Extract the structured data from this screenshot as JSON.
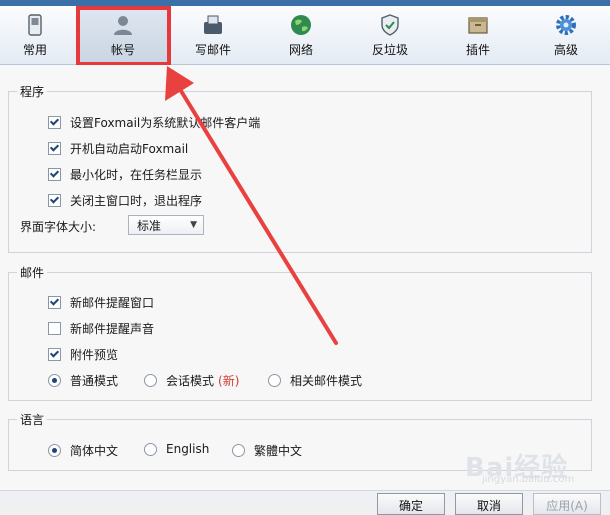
{
  "toolbar": {
    "tabs": [
      {
        "label": "常用",
        "icon": "phone-icon"
      },
      {
        "label": "帐号",
        "icon": "user-icon",
        "selected": true
      },
      {
        "label": "写邮件",
        "icon": "compose-icon"
      },
      {
        "label": "网络",
        "icon": "globe-icon"
      },
      {
        "label": "反垃圾",
        "icon": "shield-icon"
      },
      {
        "label": "插件",
        "icon": "box-icon"
      },
      {
        "label": "高级",
        "icon": "gear-icon"
      }
    ]
  },
  "program": {
    "legend": "程序",
    "items": [
      {
        "label": "设置Foxmail为系统默认邮件客户端",
        "checked": true
      },
      {
        "label": "开机自动启动Foxmail",
        "checked": true
      },
      {
        "label": "最小化时，在任务栏显示",
        "checked": true
      },
      {
        "label": "关闭主窗口时，退出程序",
        "checked": true
      }
    ],
    "font_size_label": "界面字体大小:",
    "font_size_value": "标准"
  },
  "mail": {
    "legend": "邮件",
    "items": [
      {
        "label": "新邮件提醒窗口",
        "checked": true
      },
      {
        "label": "新邮件提醒声音",
        "checked": false
      },
      {
        "label": "附件预览",
        "checked": true
      }
    ],
    "modes": [
      {
        "label": "普通模式",
        "selected": true
      },
      {
        "label": "会话模式",
        "badge": "(新)",
        "selected": false
      },
      {
        "label": "相关邮件模式",
        "selected": false
      }
    ]
  },
  "language": {
    "legend": "语言",
    "options": [
      {
        "label": "简体中文",
        "selected": true
      },
      {
        "label": "English",
        "selected": false
      },
      {
        "label": "繁體中文",
        "selected": false
      }
    ]
  },
  "buttons": {
    "ok": "确定",
    "cancel": "取消",
    "apply": "应用(A)"
  },
  "watermark": {
    "main": "Bai经验",
    "sub": "jingyan.baidu.com"
  },
  "colors": {
    "highlight": "#e5393b",
    "arrow": "#e8413f",
    "accent": "#20457a"
  }
}
